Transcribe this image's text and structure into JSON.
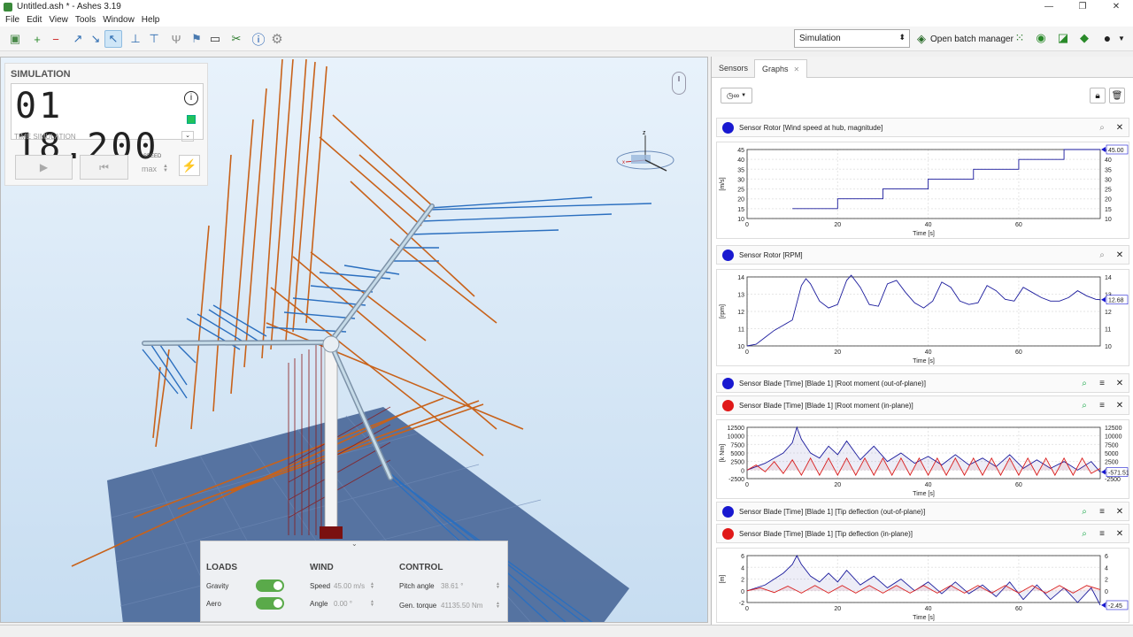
{
  "window": {
    "title": "Untitled.ash * - Ashes 3.19",
    "minimize": "—",
    "maximize": "❐",
    "close": "✕"
  },
  "menu": [
    "File",
    "Edit",
    "View",
    "Tools",
    "Window",
    "Help"
  ],
  "toolbar": {
    "mode_select": "Simulation",
    "batch_label": "Open batch manager"
  },
  "simulation": {
    "title": "SIMULATION",
    "clock": "01 18.200",
    "clock_label": "TIME SIMULATION",
    "speed_label": "SPEED",
    "speed_value": "max"
  },
  "bottom_panel": {
    "loads_title": "LOADS",
    "gravity_label": "Gravity",
    "aero_label": "Aero",
    "wind_title": "WIND",
    "speed_label": "Speed",
    "speed_value": "45.00 m/s",
    "angle_label": "Angle",
    "angle_value": "0.00 °",
    "control_title": "CONTROL",
    "pitch_label": "Pitch angle",
    "pitch_value": "38.61 °",
    "torque_label": "Gen. torque",
    "torque_value": "41135.50 Nm"
  },
  "tabs": [
    {
      "label": "Sensors"
    },
    {
      "label": "Graphs"
    }
  ],
  "graph_toolbar": {
    "timer_label": "∞"
  },
  "graphs": {
    "wind": {
      "sensor": "Sensor Rotor [Wind speed at hub, magnitude]",
      "ylabel": "[m/s]",
      "xlabel": "Time [s]",
      "readout": "45.00"
    },
    "rpm": {
      "sensor": "Sensor Rotor [RPM]",
      "ylabel": "[rpm]",
      "xlabel": "Time [s]",
      "readout": "12.68"
    },
    "root": {
      "sensor1": "Sensor Blade [Time] [Blade 1] [Root moment (out-of-plane)]",
      "sensor2": "Sensor Blade [Time] [Blade 1] [Root moment (in-plane)]",
      "ylabel": "[k Nm]",
      "xlabel": "Time [s]",
      "readout": "-571.51"
    },
    "tip": {
      "sensor1": "Sensor Blade [Time] [Blade 1] [Tip deflection (out-of-plane)]",
      "sensor2": "Sensor Blade [Time] [Blade 1] [Tip deflection (in-plane)]",
      "ylabel": "[m]",
      "xlabel": "Time [s]",
      "readout": "-2.45"
    }
  },
  "colors": {
    "series_blue": "#1a1a9c",
    "series_red": "#d81e1e",
    "accent": "#2b7fd0",
    "toggle_green": "#5aaa4a"
  },
  "chart_data": [
    {
      "type": "line",
      "name": "wind",
      "xlim": [
        0,
        78
      ],
      "ylim": [
        10,
        45
      ],
      "yticks": [
        10,
        15,
        20,
        25,
        30,
        35,
        40,
        45
      ],
      "xticks": [
        0,
        20,
        40,
        60
      ],
      "series": [
        {
          "x": [
            10,
            20,
            20,
            30,
            30,
            40,
            40,
            50,
            50,
            60,
            60,
            70,
            70,
            78
          ],
          "y": [
            15,
            15,
            20,
            20,
            25,
            25,
            30,
            30,
            35,
            35,
            40,
            40,
            45,
            45
          ]
        }
      ]
    },
    {
      "type": "line",
      "name": "rpm",
      "xlim": [
        0,
        78
      ],
      "ylim": [
        10,
        14
      ],
      "yticks": [
        10,
        11,
        12,
        13,
        14
      ],
      "xticks": [
        0,
        20,
        40,
        60
      ],
      "series": [
        {
          "x": [
            0,
            2,
            4,
            6,
            8,
            10,
            12,
            13,
            14,
            16,
            18,
            20,
            22,
            23,
            25,
            27,
            29,
            31,
            33,
            35,
            37,
            39,
            41,
            43,
            45,
            47,
            49,
            51,
            53,
            55,
            57,
            59,
            61,
            63,
            65,
            67,
            69,
            71,
            73,
            75,
            77,
            78
          ],
          "y": [
            10,
            10.1,
            10.5,
            10.9,
            11.2,
            11.5,
            13.5,
            13.9,
            13.6,
            12.6,
            12.2,
            12.4,
            13.8,
            14.1,
            13.4,
            12.4,
            12.3,
            13.6,
            13.8,
            13.1,
            12.5,
            12.2,
            12.6,
            13.7,
            13.4,
            12.6,
            12.4,
            12.5,
            13.5,
            13.2,
            12.7,
            12.6,
            13.4,
            13.1,
            12.8,
            12.6,
            12.6,
            12.8,
            13.2,
            12.9,
            12.7,
            12.68
          ]
        }
      ]
    },
    {
      "type": "line",
      "name": "root",
      "xlim": [
        0,
        78
      ],
      "ylim": [
        -2500,
        12500
      ],
      "yticks": [
        -2500,
        0,
        2500,
        5000,
        7500,
        10000,
        12500
      ],
      "xticks": [
        0,
        20,
        40,
        60
      ],
      "series": [
        {
          "x": [
            0,
            4,
            8,
            10,
            11,
            12,
            14,
            16,
            18,
            20,
            22,
            25,
            28,
            31,
            34,
            37,
            40,
            43,
            46,
            49,
            52,
            55,
            58,
            61,
            64,
            67,
            70,
            73,
            76,
            78
          ],
          "y": [
            0,
            2000,
            5000,
            8000,
            12500,
            9000,
            5000,
            3500,
            7000,
            4500,
            8500,
            3000,
            7000,
            2500,
            5000,
            2000,
            4000,
            1500,
            4500,
            1500,
            3500,
            1000,
            4500,
            500,
            3000,
            500,
            2500,
            0,
            2500,
            -571
          ]
        },
        {
          "x": [
            0,
            2,
            4,
            6,
            8,
            10,
            12,
            14,
            16,
            18,
            20,
            22,
            24,
            26,
            28,
            30,
            32,
            34,
            36,
            38,
            40,
            42,
            44,
            46,
            48,
            50,
            52,
            54,
            56,
            58,
            60,
            62,
            64,
            66,
            68,
            70,
            72,
            74,
            76,
            78
          ],
          "y": [
            0,
            1500,
            -500,
            2500,
            -1000,
            3000,
            -1500,
            3500,
            -1500,
            3500,
            -1500,
            3500,
            -1500,
            3500,
            -1500,
            3500,
            -1500,
            3500,
            -1500,
            3500,
            -1500,
            3500,
            -1500,
            3500,
            -1500,
            3500,
            -1500,
            3500,
            -1500,
            3500,
            -1500,
            3500,
            -1500,
            3500,
            -1500,
            3500,
            -1500,
            3500,
            -1000,
            500
          ]
        }
      ]
    },
    {
      "type": "line",
      "name": "tip",
      "xlim": [
        0,
        78
      ],
      "ylim": [
        -2,
        6
      ],
      "yticks": [
        -2,
        0,
        2,
        4,
        6
      ],
      "xticks": [
        0,
        20,
        40,
        60
      ],
      "series": [
        {
          "x": [
            0,
            4,
            8,
            10,
            11,
            12,
            14,
            16,
            18,
            20,
            22,
            25,
            28,
            31,
            34,
            37,
            40,
            43,
            46,
            49,
            52,
            55,
            58,
            61,
            64,
            67,
            70,
            73,
            76,
            78
          ],
          "y": [
            0,
            1,
            3,
            4.5,
            6,
            4.5,
            2.5,
            1.5,
            3,
            1.5,
            3.5,
            1,
            2.5,
            0.5,
            2,
            0,
            1.5,
            -0.5,
            1.5,
            -0.5,
            1,
            -1,
            1.5,
            -1.5,
            1,
            -1.5,
            0.5,
            -2,
            0.5,
            -2.45
          ]
        },
        {
          "x": [
            0,
            3,
            6,
            9,
            12,
            15,
            18,
            21,
            24,
            27,
            30,
            33,
            36,
            39,
            42,
            45,
            48,
            51,
            54,
            57,
            60,
            63,
            66,
            69,
            72,
            75,
            78
          ],
          "y": [
            0,
            0.5,
            -0.3,
            0.8,
            -0.4,
            0.9,
            -0.4,
            0.9,
            -0.4,
            0.9,
            -0.4,
            0.9,
            -0.4,
            0.9,
            -0.4,
            0.9,
            -0.4,
            0.9,
            -0.4,
            0.9,
            -0.4,
            0.9,
            -0.4,
            0.9,
            -0.4,
            0.9,
            0.2
          ]
        }
      ]
    }
  ]
}
